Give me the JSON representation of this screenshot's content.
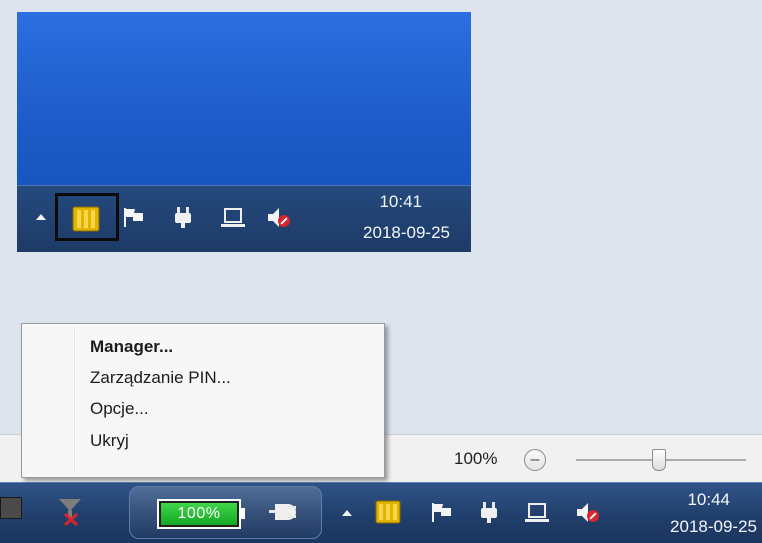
{
  "top_tray": {
    "time": "10:41",
    "date": "2018-09-25",
    "icons": [
      "show-hidden-icons-arrow",
      "sim-card-icon",
      "flag-icon",
      "power-plug-icon",
      "network-icon",
      "volume-muted-icon"
    ]
  },
  "context_menu": {
    "items": [
      {
        "label": "Manager...",
        "bold": true
      },
      {
        "label": "Zarządzanie PIN..."
      },
      {
        "label": "Opcje..."
      },
      {
        "label": "Ukryj"
      }
    ]
  },
  "status_bar": {
    "zoom": "100%",
    "zoom_out_symbol": "–",
    "zoom_level": 1.0
  },
  "bottom_taskbar": {
    "battery_percent": "100%",
    "battery_level": 1.0,
    "time": "10:44",
    "date": "2018-09-25",
    "icons": [
      "app-icon-red-x",
      "battery-icon",
      "plug-icon",
      "show-hidden-icons-arrow",
      "sim-card-icon",
      "flag-icon",
      "power-plug-icon",
      "network-icon",
      "volume-muted-icon"
    ]
  },
  "colors": {
    "desktop_blue": "#1d5cc9",
    "taskbar": "#1d3a66",
    "battery_green": "#16a825",
    "sim_yellow": "#e0b400",
    "mute_red": "#d8242a"
  }
}
